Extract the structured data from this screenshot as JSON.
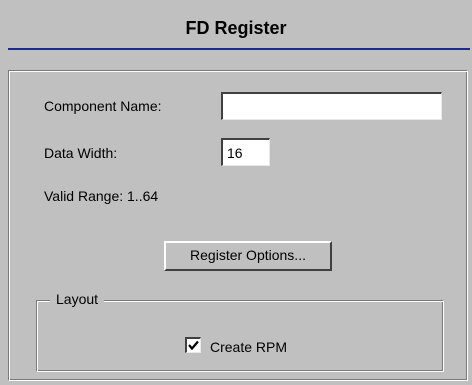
{
  "dialog": {
    "title": "FD Register"
  },
  "form": {
    "component_name_label": "Component Name:",
    "component_name_value": "",
    "data_width_label": "Data Width:",
    "data_width_value": "16",
    "valid_range_label": "Valid Range: 1..64",
    "register_options_button": "Register Options..."
  },
  "layout_group": {
    "legend": "Layout",
    "create_rpm_label": "Create RPM",
    "create_rpm_checked": true
  },
  "icons": {
    "checkbox_mark": "checkmark-icon"
  }
}
